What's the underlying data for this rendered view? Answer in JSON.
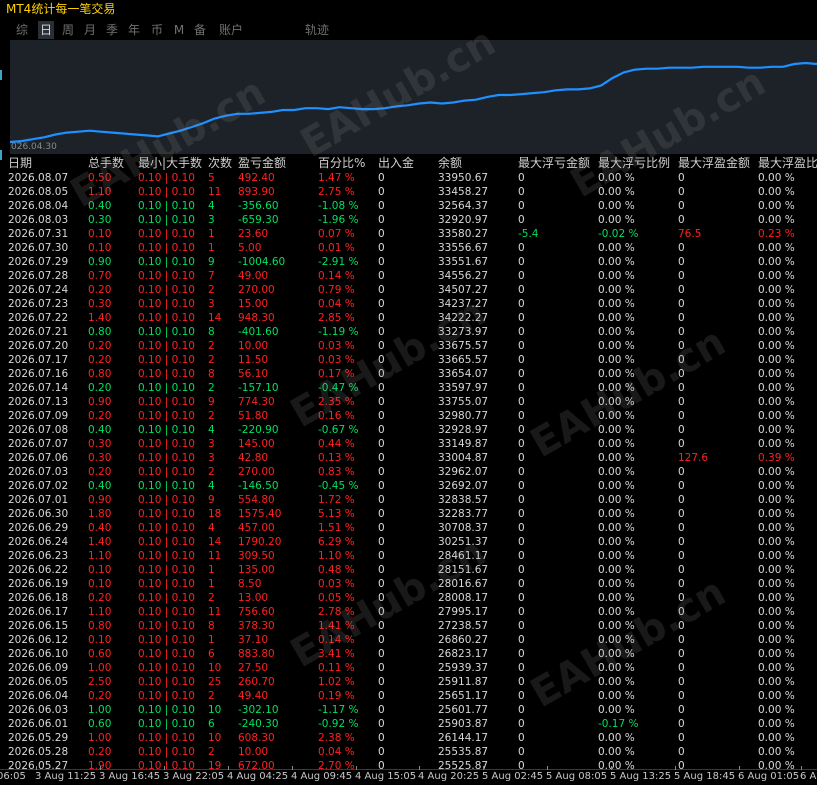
{
  "window": {
    "title": "MT4统计每一笔交易"
  },
  "tabs": [
    {
      "label": "综",
      "active": false
    },
    {
      "label": "日",
      "active": true
    },
    {
      "label": "周",
      "active": false
    },
    {
      "label": "月",
      "active": false
    },
    {
      "label": "季",
      "active": false
    },
    {
      "label": "年",
      "active": false
    },
    {
      "label": "币",
      "active": false
    },
    {
      "label": "M",
      "active": false
    },
    {
      "label": "备",
      "active": false
    },
    {
      "label": "账户",
      "active": false
    },
    {
      "label": "轨迹",
      "active": false
    }
  ],
  "chart": {
    "start_date_label": "026.04.30"
  },
  "chart_data": {
    "type": "line",
    "x": [
      "2026.04.30",
      "2026.05.27",
      "2026.06.17",
      "2026.07.08",
      "2026.07.31",
      "2026.08.07"
    ],
    "series": [
      {
        "color": "#1e90ff",
        "values": [
          0.0,
          0.01,
          0.03,
          0.05,
          0.08,
          0.1,
          0.11,
          0.12,
          0.11,
          0.1,
          0.09,
          0.08,
          0.07,
          0.06,
          0.09,
          0.12,
          0.16,
          0.2,
          0.25,
          0.28,
          0.3,
          0.3,
          0.31,
          0.32,
          0.34,
          0.34,
          0.36,
          0.36,
          0.35,
          0.37,
          0.36,
          0.35,
          0.35,
          0.36,
          0.38,
          0.39,
          0.41,
          0.42,
          0.41,
          0.42,
          0.44,
          0.45,
          0.48,
          0.5,
          0.5,
          0.51,
          0.52,
          0.53,
          0.55,
          0.56,
          0.56,
          0.57,
          0.6,
          0.68,
          0.74,
          0.77,
          0.78,
          0.78,
          0.79,
          0.79,
          0.79,
          0.8,
          0.8,
          0.8,
          0.8,
          0.79,
          0.79,
          0.8,
          0.8,
          0.83,
          0.84,
          0.83
        ]
      }
    ],
    "grid": false
  },
  "table": {
    "headers": [
      "日期",
      "总手数",
      "最小|大手数",
      "次数",
      "盈亏金额",
      "百分比%",
      "出入金",
      "余额",
      "最大浮亏金额",
      "最大浮亏比例",
      "最大浮盈金额",
      "最大浮盈比例"
    ],
    "rows": [
      [
        "2026.08.07",
        "0.50",
        "0.10 | 0.10",
        "5",
        "492.40",
        "1.47 %",
        "0",
        "33950.67",
        "0",
        "0.00 %",
        "0",
        "0.00 %"
      ],
      [
        "2026.08.05",
        "1.10",
        "0.10 | 0.10",
        "11",
        "893.90",
        "2.75 %",
        "0",
        "33458.27",
        "0",
        "0.00 %",
        "0",
        "0.00 %"
      ],
      [
        "2026.08.04",
        "0.40",
        "0.10 | 0.10",
        "4",
        "-356.60",
        "-1.08 %",
        "0",
        "32564.37",
        "0",
        "0.00 %",
        "0",
        "0.00 %"
      ],
      [
        "2026.08.03",
        "0.30",
        "0.10 | 0.10",
        "3",
        "-659.30",
        "-1.96 %",
        "0",
        "32920.97",
        "0",
        "0.00 %",
        "0",
        "0.00 %"
      ],
      [
        "2026.07.31",
        "0.10",
        "0.10 | 0.10",
        "1",
        "23.60",
        "0.07 %",
        "0",
        "33580.27",
        "-5.4",
        "-0.02 %",
        "76.5",
        "0.23 %"
      ],
      [
        "2026.07.30",
        "0.10",
        "0.10 | 0.10",
        "1",
        "5.00",
        "0.01 %",
        "0",
        "33556.67",
        "0",
        "0.00 %",
        "0",
        "0.00 %"
      ],
      [
        "2026.07.29",
        "0.90",
        "0.10 | 0.10",
        "9",
        "-1004.60",
        "-2.91 %",
        "0",
        "33551.67",
        "0",
        "0.00 %",
        "0",
        "0.00 %"
      ],
      [
        "2026.07.28",
        "0.70",
        "0.10 | 0.10",
        "7",
        "49.00",
        "0.14 %",
        "0",
        "34556.27",
        "0",
        "0.00 %",
        "0",
        "0.00 %"
      ],
      [
        "2026.07.24",
        "0.20",
        "0.10 | 0.10",
        "2",
        "270.00",
        "0.79 %",
        "0",
        "34507.27",
        "0",
        "0.00 %",
        "0",
        "0.00 %"
      ],
      [
        "2026.07.23",
        "0.30",
        "0.10 | 0.10",
        "3",
        "15.00",
        "0.04 %",
        "0",
        "34237.27",
        "0",
        "0.00 %",
        "0",
        "0.00 %"
      ],
      [
        "2026.07.22",
        "1.40",
        "0.10 | 0.10",
        "14",
        "948.30",
        "2.85 %",
        "0",
        "34222.27",
        "0",
        "0.00 %",
        "0",
        "0.00 %"
      ],
      [
        "2026.07.21",
        "0.80",
        "0.10 | 0.10",
        "8",
        "-401.60",
        "-1.19 %",
        "0",
        "33273.97",
        "0",
        "0.00 %",
        "0",
        "0.00 %"
      ],
      [
        "2026.07.20",
        "0.20",
        "0.10 | 0.10",
        "2",
        "10.00",
        "0.03 %",
        "0",
        "33675.57",
        "0",
        "0.00 %",
        "0",
        "0.00 %"
      ],
      [
        "2026.07.17",
        "0.20",
        "0.10 | 0.10",
        "2",
        "11.50",
        "0.03 %",
        "0",
        "33665.57",
        "0",
        "0.00 %",
        "0",
        "0.00 %"
      ],
      [
        "2026.07.16",
        "0.80",
        "0.10 | 0.10",
        "8",
        "56.10",
        "0.17 %",
        "0",
        "33654.07",
        "0",
        "0.00 %",
        "0",
        "0.00 %"
      ],
      [
        "2026.07.14",
        "0.20",
        "0.10 | 0.10",
        "2",
        "-157.10",
        "-0.47 %",
        "0",
        "33597.97",
        "0",
        "0.00 %",
        "0",
        "0.00 %"
      ],
      [
        "2026.07.13",
        "0.90",
        "0.10 | 0.10",
        "9",
        "774.30",
        "2.35 %",
        "0",
        "33755.07",
        "0",
        "0.00 %",
        "0",
        "0.00 %"
      ],
      [
        "2026.07.09",
        "0.20",
        "0.10 | 0.10",
        "2",
        "51.80",
        "0.16 %",
        "0",
        "32980.77",
        "0",
        "0.00 %",
        "0",
        "0.00 %"
      ],
      [
        "2026.07.08",
        "0.40",
        "0.10 | 0.10",
        "4",
        "-220.90",
        "-0.67 %",
        "0",
        "32928.97",
        "0",
        "0.00 %",
        "0",
        "0.00 %"
      ],
      [
        "2026.07.07",
        "0.30",
        "0.10 | 0.10",
        "3",
        "145.00",
        "0.44 %",
        "0",
        "33149.87",
        "0",
        "0.00 %",
        "0",
        "0.00 %"
      ],
      [
        "2026.07.06",
        "0.30",
        "0.10 | 0.10",
        "3",
        "42.80",
        "0.13 %",
        "0",
        "33004.87",
        "0",
        "0.00 %",
        "127.6",
        "0.39 %"
      ],
      [
        "2026.07.03",
        "0.20",
        "0.10 | 0.10",
        "2",
        "270.00",
        "0.83 %",
        "0",
        "32962.07",
        "0",
        "0.00 %",
        "0",
        "0.00 %"
      ],
      [
        "2026.07.02",
        "0.40",
        "0.10 | 0.10",
        "4",
        "-146.50",
        "-0.45 %",
        "0",
        "32692.07",
        "0",
        "0.00 %",
        "0",
        "0.00 %"
      ],
      [
        "2026.07.01",
        "0.90",
        "0.10 | 0.10",
        "9",
        "554.80",
        "1.72 %",
        "0",
        "32838.57",
        "0",
        "0.00 %",
        "0",
        "0.00 %"
      ],
      [
        "2026.06.30",
        "1.80",
        "0.10 | 0.10",
        "18",
        "1575.40",
        "5.13 %",
        "0",
        "32283.77",
        "0",
        "0.00 %",
        "0",
        "0.00 %"
      ],
      [
        "2026.06.29",
        "0.40",
        "0.10 | 0.10",
        "4",
        "457.00",
        "1.51 %",
        "0",
        "30708.37",
        "0",
        "0.00 %",
        "0",
        "0.00 %"
      ],
      [
        "2026.06.24",
        "1.40",
        "0.10 | 0.10",
        "14",
        "1790.20",
        "6.29 %",
        "0",
        "30251.37",
        "0",
        "0.00 %",
        "0",
        "0.00 %"
      ],
      [
        "2026.06.23",
        "1.10",
        "0.10 | 0.10",
        "11",
        "309.50",
        "1.10 %",
        "0",
        "28461.17",
        "0",
        "0.00 %",
        "0",
        "0.00 %"
      ],
      [
        "2026.06.22",
        "0.10",
        "0.10 | 0.10",
        "1",
        "135.00",
        "0.48 %",
        "0",
        "28151.67",
        "0",
        "0.00 %",
        "0",
        "0.00 %"
      ],
      [
        "2026.06.19",
        "0.10",
        "0.10 | 0.10",
        "1",
        "8.50",
        "0.03 %",
        "0",
        "28016.67",
        "0",
        "0.00 %",
        "0",
        "0.00 %"
      ],
      [
        "2026.06.18",
        "0.20",
        "0.10 | 0.10",
        "2",
        "13.00",
        "0.05 %",
        "0",
        "28008.17",
        "0",
        "0.00 %",
        "0",
        "0.00 %"
      ],
      [
        "2026.06.17",
        "1.10",
        "0.10 | 0.10",
        "11",
        "756.60",
        "2.78 %",
        "0",
        "27995.17",
        "0",
        "0.00 %",
        "0",
        "0.00 %"
      ],
      [
        "2026.06.15",
        "0.80",
        "0.10 | 0.10",
        "8",
        "378.30",
        "1.41 %",
        "0",
        "27238.57",
        "0",
        "0.00 %",
        "0",
        "0.00 %"
      ],
      [
        "2026.06.12",
        "0.10",
        "0.10 | 0.10",
        "1",
        "37.10",
        "0.14 %",
        "0",
        "26860.27",
        "0",
        "0.00 %",
        "0",
        "0.00 %"
      ],
      [
        "2026.06.10",
        "0.60",
        "0.10 | 0.10",
        "6",
        "883.80",
        "3.41 %",
        "0",
        "26823.17",
        "0",
        "0.00 %",
        "0",
        "0.00 %"
      ],
      [
        "2026.06.09",
        "1.00",
        "0.10 | 0.10",
        "10",
        "27.50",
        "0.11 %",
        "0",
        "25939.37",
        "0",
        "0.00 %",
        "0",
        "0.00 %"
      ],
      [
        "2026.06.05",
        "2.50",
        "0.10 | 0.10",
        "25",
        "260.70",
        "1.02 %",
        "0",
        "25911.87",
        "0",
        "0.00 %",
        "0",
        "0.00 %"
      ],
      [
        "2026.06.04",
        "0.20",
        "0.10 | 0.10",
        "2",
        "49.40",
        "0.19 %",
        "0",
        "25651.17",
        "0",
        "0.00 %",
        "0",
        "0.00 %"
      ],
      [
        "2026.06.03",
        "1.00",
        "0.10 | 0.10",
        "10",
        "-302.10",
        "-1.17 %",
        "0",
        "25601.77",
        "0",
        "0.00 %",
        "0",
        "0.00 %"
      ],
      [
        "2026.06.01",
        "0.60",
        "0.10 | 0.10",
        "6",
        "-240.30",
        "-0.92 %",
        "0",
        "25903.87",
        "0",
        "-0.17 %",
        "0",
        "0.00 %"
      ],
      [
        "2026.05.29",
        "1.00",
        "0.10 | 0.10",
        "10",
        "608.30",
        "2.38 %",
        "0",
        "26144.17",
        "0",
        "0.00 %",
        "0",
        "0.00 %"
      ],
      [
        "2026.05.28",
        "0.20",
        "0.10 | 0.10",
        "2",
        "10.00",
        "0.04 %",
        "0",
        "25535.87",
        "0",
        "0.00 %",
        "0",
        "0.00 %"
      ],
      [
        "2026.05.27",
        "1.90",
        "0.10 | 0.10",
        "19",
        "672.00",
        "2.70 %",
        "0",
        "25525.87",
        "0",
        "0.00 %",
        "0",
        "0.00 %"
      ]
    ]
  },
  "time_axis": [
    "06:05",
    "3 Aug 11:25",
    "3 Aug 16:45",
    "3 Aug 22:05",
    "4 Aug 04:25",
    "4 Aug 09:45",
    "4 Aug 15:05",
    "4 Aug 20:25",
    "5 Aug 02:45",
    "5 Aug 08:05",
    "5 Aug 13:25",
    "5 Aug 18:45",
    "6 Aug 01:05",
    "6 A"
  ],
  "watermark": "EAHub.cn",
  "colors": {
    "title": "#ffd200",
    "profit": "#ff2020",
    "loss": "#00e060",
    "neutral": "#d8d8d8",
    "chart_bg": "#1d2228",
    "chart_line": "#1e90ff"
  }
}
